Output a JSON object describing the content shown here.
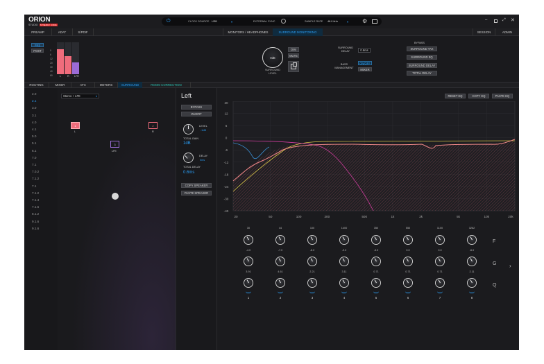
{
  "app": {
    "logo": "ORION",
    "logo_sub": "STUDIO",
    "logo_badge": "SYNERGY CORE"
  },
  "topbar": {
    "clock_label": "CLOCK SOURCE",
    "clock_value": "USB",
    "ext_label": "EXTERNAL SYNC",
    "sr_label": "SAMPLE RATE",
    "sr_value": "48.0 kHz"
  },
  "tabs1": [
    {
      "label": "PREAMP"
    },
    {
      "label": "ADAT"
    },
    {
      "label": "S/PDIF"
    }
  ],
  "tabs1b": {
    "monitors": "MONITORS / HEADPHONES",
    "surround": "SURROUND MONITORING",
    "session": "SESSION",
    "admin": "ADMIN"
  },
  "meter": {
    "pre": "PRE",
    "post": "POST",
    "scale": [
      "0",
      "6",
      "12",
      "20",
      "30",
      "40",
      "60"
    ],
    "labels": [
      "L",
      "R",
      "LFE"
    ],
    "levels": [
      0.78,
      0.57,
      0.38
    ]
  },
  "surround_level": {
    "value": "0dB",
    "label1": "SURROUND",
    "label2": "LEVEL",
    "dim": "DIM",
    "mute": "MUTE"
  },
  "delay": {
    "label1": "SURROUND",
    "label2": "DELAY",
    "value": "0.6ms",
    "bass1": "BASS",
    "bass2": "MANAGEMENT",
    "onoff": "ON/OFF",
    "mixer": "MIXER"
  },
  "bypass": {
    "title": "BYPASS",
    "items": [
      "SURROUND TAX",
      "SURROUND EQ",
      "SURROUND DELAY",
      "TOTAL DELAY"
    ]
  },
  "tabs2": [
    {
      "label": "ROUTING"
    },
    {
      "label": "MIXER"
    },
    {
      "label": "AFX"
    },
    {
      "label": "METERS"
    },
    {
      "label": "SURROUND"
    },
    {
      "label": "ROOM CORRECTION"
    }
  ],
  "formats": [
    "2.0",
    "2.1",
    "3.0",
    "3.1",
    "4.0",
    "4.1",
    "5.0",
    "5.1",
    "6.1",
    "7.0",
    "7.1",
    "7.0.2",
    "7.1.2",
    "7.1",
    "7.1.2",
    "7.1.4",
    "7.1.6",
    "8.1.2",
    "9.1.6",
    "9.1.6"
  ],
  "format_selected": 1,
  "dropdown": "Stereo + LFE",
  "speakers": [
    {
      "num": "1",
      "label": "L"
    },
    {
      "num": "2",
      "label": "R"
    },
    {
      "num": "3",
      "label": "LFE"
    }
  ],
  "channel": {
    "name": "Left",
    "bypass": "BYPASS",
    "invert": "INVERT",
    "level_label": "LEVEL",
    "level_value": "-1dB",
    "total_gain_label": "TOTAL GAIN",
    "total_gain_value": "1dB",
    "delay_label": "DELAY",
    "delay_value": "0ms",
    "total_delay_label": "TOTAL DELAY",
    "total_delay_value": "0.6ms",
    "copy": "COPY SPEAKER",
    "paste": "PASTE SPEAKER"
  },
  "eq_buttons": {
    "reset": "RESET EQ",
    "copy": "COPY EQ",
    "paste": "PASTE EQ"
  },
  "eq_graph": {
    "y_ticks": [
      "20",
      "12",
      "6",
      "0",
      "-6",
      "-12",
      "-18",
      "-24",
      "-30",
      "-40"
    ],
    "x_ticks": [
      "20",
      "50",
      "100",
      "200",
      "500",
      "1k",
      "2k",
      "5k",
      "10k",
      "20k"
    ]
  },
  "bands": {
    "freq": [
      "30",
      "44",
      "100",
      "1400",
      "350",
      "550",
      "1100",
      "3262"
    ],
    "gain": [
      "-4.0",
      "-7.0",
      "-6.0",
      "-9.0",
      "-3.0",
      "0.0",
      "0.0",
      "-6.0"
    ],
    "q": [
      "3.91",
      "4.61",
      "2.21",
      "3.11",
      "0.71",
      "0.71",
      "0.71",
      "2.11"
    ],
    "num": [
      "1",
      "2",
      "3",
      "4",
      "5",
      "6",
      "7",
      "8"
    ]
  },
  "row_labels": {
    "f": "F",
    "g": "G",
    "q": "Q"
  },
  "colors": {
    "accent": "#2a9df4",
    "pink": "#f06c7c",
    "lfe": "#9b6bd6"
  }
}
